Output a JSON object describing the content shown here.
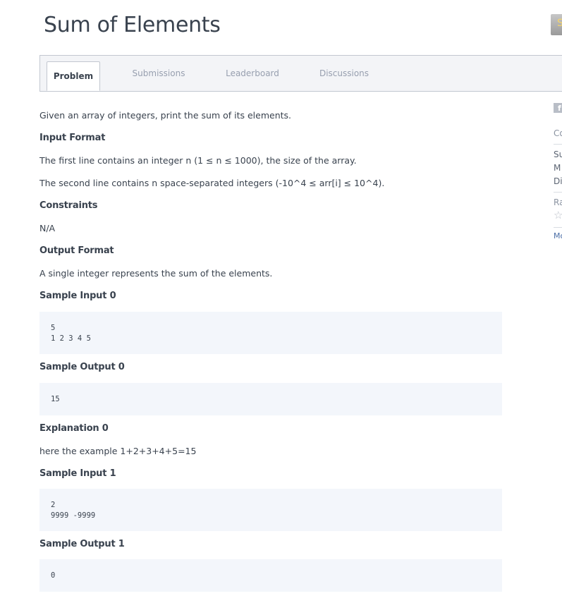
{
  "page": {
    "title": "Sum of Elements",
    "top_right_button_glyph": "S"
  },
  "tabs": [
    {
      "label": "Problem",
      "active": true
    },
    {
      "label": "Submissions",
      "active": false
    },
    {
      "label": "Leaderboard",
      "active": false
    },
    {
      "label": "Discussions",
      "active": false
    }
  ],
  "problem": {
    "intro": "Given an array of integers, print the sum of its elements.",
    "input_format_heading": "Input Format",
    "input_format_line1": "The first line contains an integer n (1 ≤ n ≤ 1000), the size of the array.",
    "input_format_line2": "The second line contains n space-separated integers (-10^4 ≤ arr[i] ≤ 10^4).",
    "constraints_heading": "Constraints",
    "constraints_text": "N/A",
    "output_format_heading": "Output Format",
    "output_format_text": "A single integer represents the sum of the elements.",
    "sample_input_0_heading": "Sample Input 0",
    "sample_input_0": [
      "5",
      "1 2 3 4 5"
    ],
    "sample_output_0_heading": "Sample Output 0",
    "sample_output_0": [
      "15"
    ],
    "explanation_0_heading": "Explanation 0",
    "explanation_0_text": "here the example 1+2+3+4+5=15",
    "sample_input_1_heading": "Sample Input 1",
    "sample_input_1": [
      "2",
      "9999 -9999"
    ],
    "sample_output_1_heading": "Sample Output 1",
    "sample_output_1": [
      "0"
    ]
  },
  "sidebar": {
    "facebook_icon": "f",
    "item_co": "Co",
    "item_su": "Su",
    "item_m": "M",
    "item_di": "Di",
    "item_ra": "Ra",
    "item_mo": "Mo",
    "star_icon": "star-outline-icon"
  },
  "colors": {
    "text": "#39424e",
    "muted_tab": "#979faf",
    "code_bg": "#f3f6fb",
    "tab_bar_bg": "#f3f4f7",
    "border": "#c2c7d0"
  }
}
